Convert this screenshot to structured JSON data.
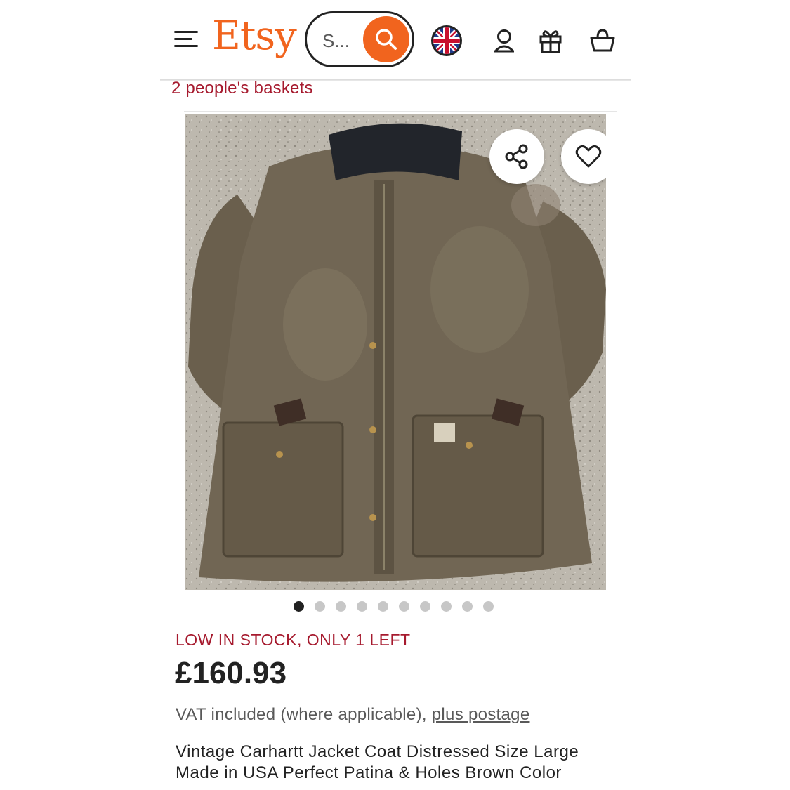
{
  "header": {
    "logo": "Etsy",
    "search_placeholder": "S...",
    "icons": [
      "menu-icon",
      "search-icon",
      "uk-flag-icon",
      "user-icon",
      "gift-icon",
      "basket-icon"
    ]
  },
  "basket_note": "2 people's baskets",
  "gallery": {
    "image_count": 10,
    "active_index": 0,
    "overlay_icons": [
      "share-icon",
      "heart-icon"
    ]
  },
  "listing": {
    "stock_message": "LOW IN STOCK, ONLY 1 LEFT",
    "price": "£160.93",
    "vat_text": "VAT included (where applicable),",
    "postage_link": "plus postage",
    "title": "Vintage Carhartt Jacket Coat Distressed Size Large Made in USA Perfect Patina & Holes Brown Color"
  },
  "colors": {
    "brand": "#f1641e",
    "alert": "#a61a2e",
    "text": "#222222",
    "muted": "#595959"
  }
}
